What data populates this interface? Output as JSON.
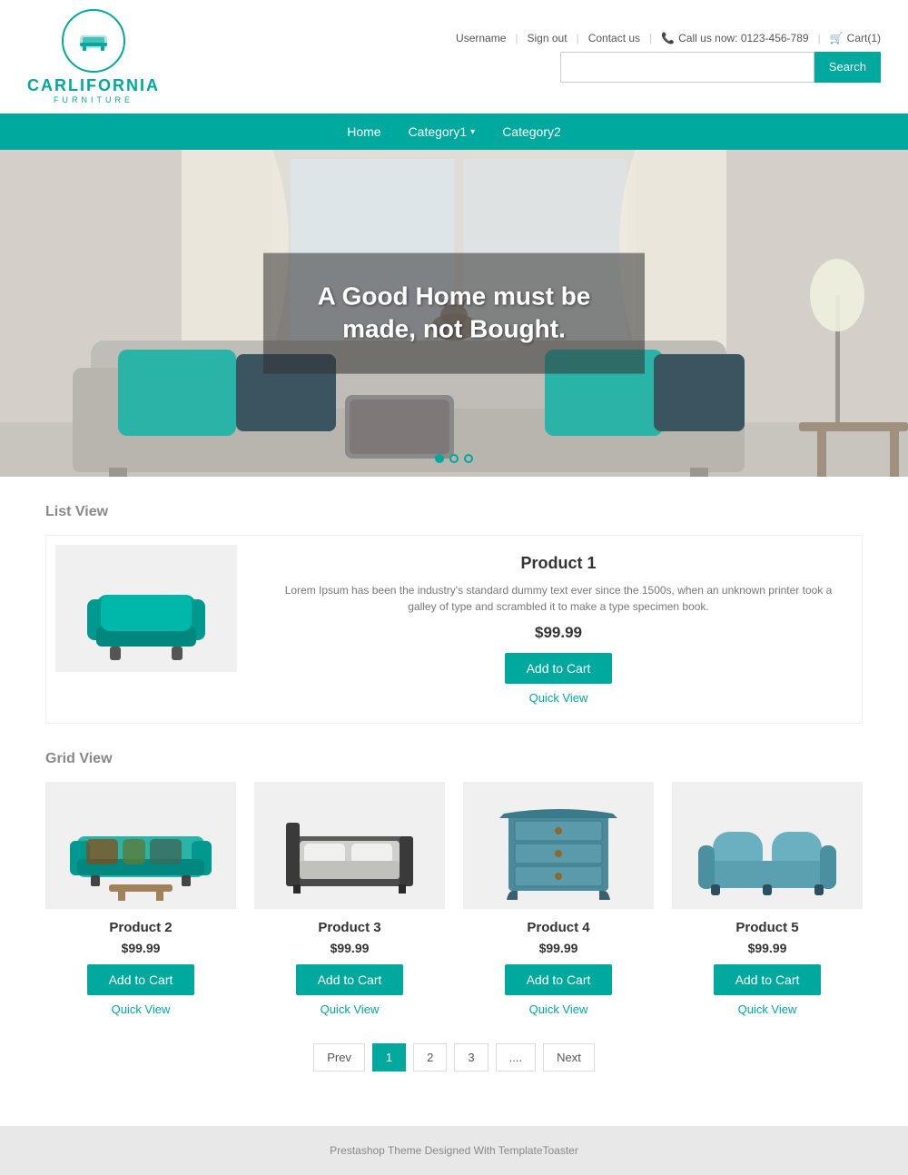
{
  "brand": {
    "name": "CARLIFORNIA",
    "subtitle": "FURNITURE",
    "tagline": "A Good Home must be made, not Bought."
  },
  "topLinks": {
    "username": "Username",
    "signout": "Sign out",
    "contact": "Contact us",
    "phone": "Call us now: 0123-456-789",
    "cart": "Cart(1)"
  },
  "search": {
    "placeholder": "",
    "button": "Search"
  },
  "nav": {
    "items": [
      {
        "label": "Home",
        "hasDropdown": false
      },
      {
        "label": "Category1",
        "hasDropdown": true
      },
      {
        "label": "Category2",
        "hasDropdown": false
      }
    ]
  },
  "hero": {
    "text": "A Good Home must be made, not Bought.",
    "dots": [
      true,
      false,
      false
    ]
  },
  "sections": {
    "listView": {
      "title": "List View",
      "products": [
        {
          "name": "Product 1",
          "description": "Lorem Ipsum has been the industry's standard dummy text ever since the 1500s, when an unknown printer took a galley of type and scrambled it to make a type specimen book.",
          "price": "$99.99",
          "addToCart": "Add to Cart",
          "quickView": "Quick View"
        }
      ]
    },
    "gridView": {
      "title": "Grid View",
      "products": [
        {
          "name": "Product 2",
          "price": "$99.99",
          "addToCart": "Add to Cart",
          "quickView": "Quick View"
        },
        {
          "name": "Product 3",
          "price": "$99.99",
          "addToCart": "Add to Cart",
          "quickView": "Quick View"
        },
        {
          "name": "Product 4",
          "price": "$99.99",
          "addToCart": "Add to Cart",
          "quickView": "Quick View"
        },
        {
          "name": "Product 5",
          "price": "$99.99",
          "addToCart": "Add to Cart",
          "quickView": "Quick View"
        }
      ]
    }
  },
  "pagination": {
    "prev": "Prev",
    "pages": [
      "1",
      "2",
      "3",
      "...."
    ],
    "next": "Next",
    "activePage": "1"
  },
  "footer": {
    "text": "Prestashop Theme Designed With TemplateToaster"
  },
  "colors": {
    "primary": "#00a99d",
    "text": "#333333",
    "light": "#888888"
  }
}
